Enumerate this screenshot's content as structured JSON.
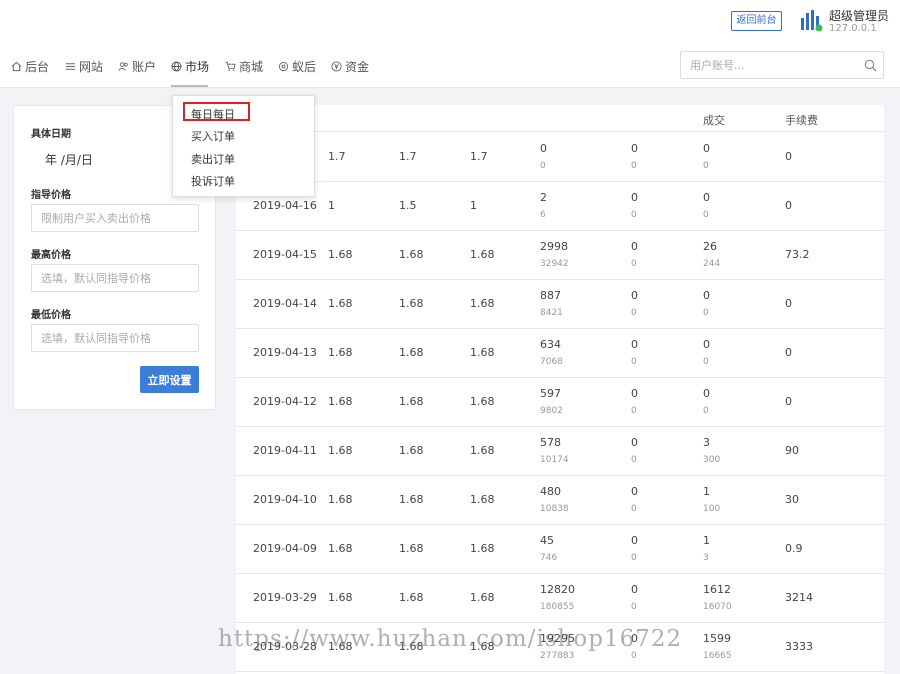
{
  "header": {
    "back_label": "返回前台",
    "admin_name": "超级管理员",
    "admin_ip": "127.0.0.1"
  },
  "nav": {
    "items": [
      {
        "label": "后台",
        "icon": "home-icon"
      },
      {
        "label": "网站",
        "icon": "list-icon"
      },
      {
        "label": "账户",
        "icon": "users-icon"
      },
      {
        "label": "市场",
        "icon": "globe-icon"
      },
      {
        "label": "商城",
        "icon": "cart-icon"
      },
      {
        "label": "蚁后",
        "icon": "gear-icon"
      },
      {
        "label": "资金",
        "icon": "coin-icon"
      }
    ],
    "search_placeholder": "用户账号..."
  },
  "dropdown": {
    "items": [
      "每日每日",
      "买入订单",
      "卖出订单",
      "投诉订单"
    ]
  },
  "form": {
    "date_label": "具体日期",
    "date_value": "年 /月/日",
    "guide_label": "指导价格",
    "guide_placeholder": "限制用户买入卖出价格",
    "max_label": "最高价格",
    "max_placeholder": "选填，默认同指导价格",
    "min_label": "最低价格",
    "min_placeholder": "选填，默认同指导价格",
    "submit_label": "立即设置"
  },
  "table": {
    "headers": {
      "deal": "成交",
      "fee": "手续费"
    },
    "rows": [
      {
        "date": "",
        "c1": "1.7",
        "c2": "1.7",
        "c3": "1.7",
        "c4": "0",
        "c4s": "0",
        "c5": "0",
        "c5s": "0",
        "c6": "0",
        "c6s": "0",
        "fee": "0"
      },
      {
        "date": "2019-04-16",
        "c1": "1",
        "c2": "1.5",
        "c3": "1",
        "c4": "2",
        "c4s": "6",
        "c5": "0",
        "c5s": "0",
        "c6": "0",
        "c6s": "0",
        "fee": "0"
      },
      {
        "date": "2019-04-15",
        "c1": "1.68",
        "c2": "1.68",
        "c3": "1.68",
        "c4": "2998",
        "c4s": "32942",
        "c5": "0",
        "c5s": "0",
        "c6": "26",
        "c6s": "244",
        "fee": "73.2"
      },
      {
        "date": "2019-04-14",
        "c1": "1.68",
        "c2": "1.68",
        "c3": "1.68",
        "c4": "887",
        "c4s": "8421",
        "c5": "0",
        "c5s": "0",
        "c6": "0",
        "c6s": "0",
        "fee": "0"
      },
      {
        "date": "2019-04-13",
        "c1": "1.68",
        "c2": "1.68",
        "c3": "1.68",
        "c4": "634",
        "c4s": "7068",
        "c5": "0",
        "c5s": "0",
        "c6": "0",
        "c6s": "0",
        "fee": "0"
      },
      {
        "date": "2019-04-12",
        "c1": "1.68",
        "c2": "1.68",
        "c3": "1.68",
        "c4": "597",
        "c4s": "9802",
        "c5": "0",
        "c5s": "0",
        "c6": "0",
        "c6s": "0",
        "fee": "0"
      },
      {
        "date": "2019-04-11",
        "c1": "1.68",
        "c2": "1.68",
        "c3": "1.68",
        "c4": "578",
        "c4s": "10174",
        "c5": "0",
        "c5s": "0",
        "c6": "3",
        "c6s": "300",
        "fee": "90"
      },
      {
        "date": "2019-04-10",
        "c1": "1.68",
        "c2": "1.68",
        "c3": "1.68",
        "c4": "480",
        "c4s": "10838",
        "c5": "0",
        "c5s": "0",
        "c6": "1",
        "c6s": "100",
        "fee": "30"
      },
      {
        "date": "2019-04-09",
        "c1": "1.68",
        "c2": "1.68",
        "c3": "1.68",
        "c4": "45",
        "c4s": "746",
        "c5": "0",
        "c5s": "0",
        "c6": "1",
        "c6s": "3",
        "fee": "0.9"
      },
      {
        "date": "2019-03-29",
        "c1": "1.68",
        "c2": "1.68",
        "c3": "1.68",
        "c4": "12820",
        "c4s": "180855",
        "c5": "0",
        "c5s": "0",
        "c6": "1612",
        "c6s": "16070",
        "fee": "3214"
      },
      {
        "date": "2019-03-28",
        "c1": "1.68",
        "c2": "1.68",
        "c3": "1.68",
        "c4": "19295",
        "c4s": "277883",
        "c5": "0",
        "c5s": "0",
        "c6": "1599",
        "c6s": "16665",
        "fee": "3333"
      }
    ]
  },
  "watermark": "https://www.huzhan.com/ishop16722"
}
